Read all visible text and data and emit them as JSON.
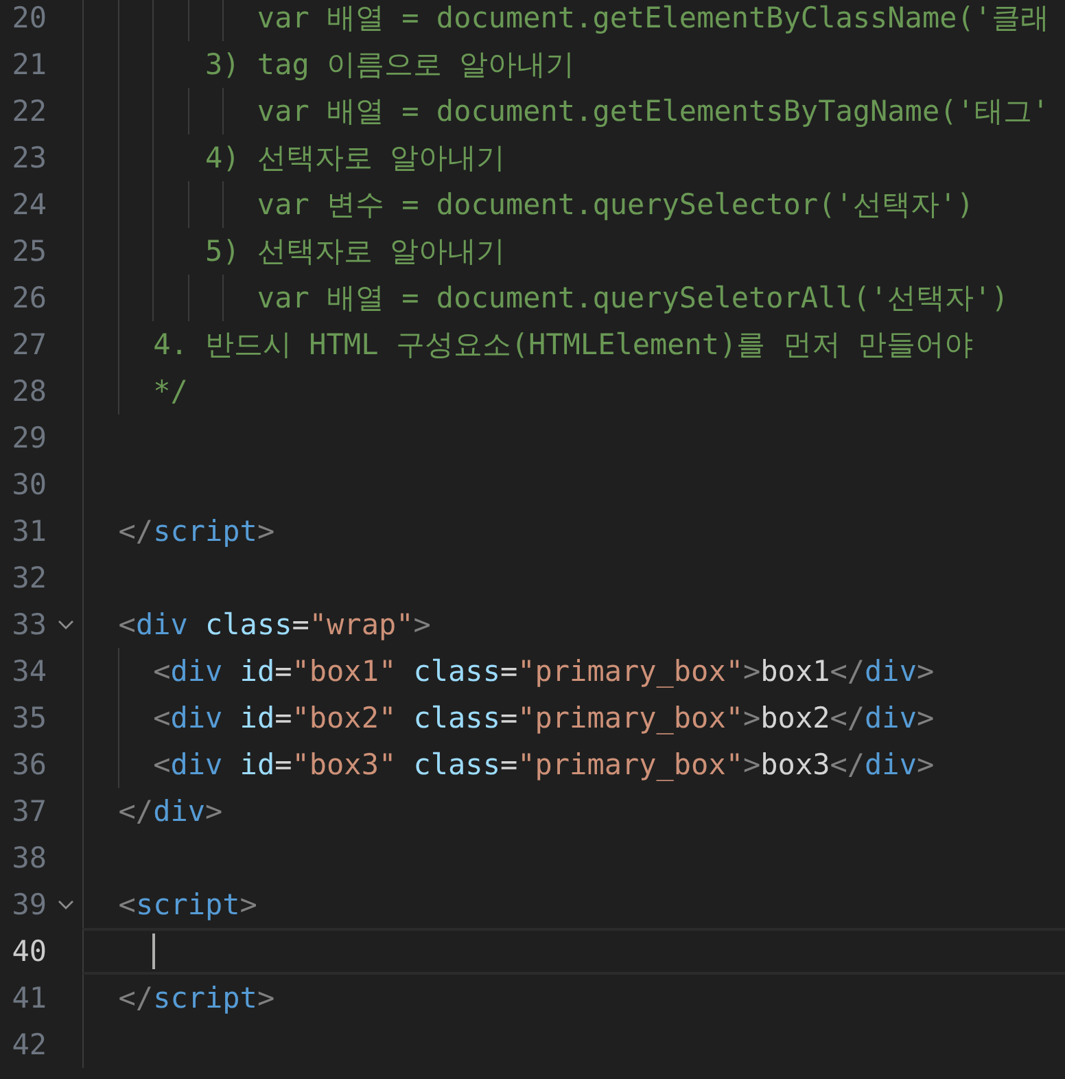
{
  "editor": {
    "lines": [
      {
        "number": "20",
        "fold": false,
        "current": false,
        "tokens": [
          {
            "kind": "comment",
            "text": "          var 배열 = document.getElementByClassName('클래"
          }
        ]
      },
      {
        "number": "21",
        "fold": false,
        "current": false,
        "tokens": [
          {
            "kind": "comment",
            "text": "       3) tag 이름으로 알아내기"
          }
        ]
      },
      {
        "number": "22",
        "fold": false,
        "current": false,
        "tokens": [
          {
            "kind": "comment",
            "text": "          var 배열 = document.getElementsByTagName('태그'"
          }
        ]
      },
      {
        "number": "23",
        "fold": false,
        "current": false,
        "tokens": [
          {
            "kind": "comment",
            "text": "       4) 선택자로 알아내기"
          }
        ]
      },
      {
        "number": "24",
        "fold": false,
        "current": false,
        "tokens": [
          {
            "kind": "comment",
            "text": "          var 변수 = document.querySelector('선택자')"
          }
        ]
      },
      {
        "number": "25",
        "fold": false,
        "current": false,
        "tokens": [
          {
            "kind": "comment",
            "text": "       5) 선택자로 알아내기"
          }
        ]
      },
      {
        "number": "26",
        "fold": false,
        "current": false,
        "tokens": [
          {
            "kind": "comment",
            "text": "          var 배열 = document.querySeletorAll('선택자')"
          }
        ]
      },
      {
        "number": "27",
        "fold": false,
        "current": false,
        "tokens": [
          {
            "kind": "comment",
            "text": "    4. 반드시 HTML 구성요소(HTMLElement)를 먼저 만들어야"
          }
        ]
      },
      {
        "number": "28",
        "fold": false,
        "current": false,
        "tokens": [
          {
            "kind": "comment",
            "text": "    */"
          }
        ]
      },
      {
        "number": "29",
        "fold": false,
        "current": false
      },
      {
        "number": "30",
        "fold": false,
        "current": false
      },
      {
        "number": "31",
        "fold": false,
        "current": false,
        "tokens": [
          {
            "kind": "punct",
            "text": "  </"
          },
          {
            "kind": "tag",
            "text": "script"
          },
          {
            "kind": "punct",
            "text": ">"
          }
        ]
      },
      {
        "number": "32",
        "fold": false,
        "current": false
      },
      {
        "number": "33",
        "fold": true,
        "current": false,
        "tokens": [
          {
            "kind": "punct",
            "text": "  <"
          },
          {
            "kind": "tag",
            "text": "div"
          },
          {
            "kind": "attr",
            "text": " class"
          },
          {
            "kind": "plain",
            "text": "="
          },
          {
            "kind": "string",
            "text": "\"wrap\""
          },
          {
            "kind": "punct",
            "text": ">"
          }
        ]
      },
      {
        "number": "34",
        "fold": false,
        "current": false,
        "tokens": [
          {
            "kind": "punct",
            "text": "    <"
          },
          {
            "kind": "tag",
            "text": "div"
          },
          {
            "kind": "attr",
            "text": " id"
          },
          {
            "kind": "plain",
            "text": "="
          },
          {
            "kind": "string",
            "text": "\"box1\""
          },
          {
            "kind": "attr",
            "text": " class"
          },
          {
            "kind": "plain",
            "text": "="
          },
          {
            "kind": "string",
            "text": "\"primary_box\""
          },
          {
            "kind": "punct",
            "text": ">"
          },
          {
            "kind": "plain",
            "text": "box1"
          },
          {
            "kind": "punct",
            "text": "</"
          },
          {
            "kind": "tag",
            "text": "div"
          },
          {
            "kind": "punct",
            "text": ">"
          }
        ]
      },
      {
        "number": "35",
        "fold": false,
        "current": false,
        "tokens": [
          {
            "kind": "punct",
            "text": "    <"
          },
          {
            "kind": "tag",
            "text": "div"
          },
          {
            "kind": "attr",
            "text": " id"
          },
          {
            "kind": "plain",
            "text": "="
          },
          {
            "kind": "string",
            "text": "\"box2\""
          },
          {
            "kind": "attr",
            "text": " class"
          },
          {
            "kind": "plain",
            "text": "="
          },
          {
            "kind": "string",
            "text": "\"primary_box\""
          },
          {
            "kind": "punct",
            "text": ">"
          },
          {
            "kind": "plain",
            "text": "box2"
          },
          {
            "kind": "punct",
            "text": "</"
          },
          {
            "kind": "tag",
            "text": "div"
          },
          {
            "kind": "punct",
            "text": ">"
          }
        ]
      },
      {
        "number": "36",
        "fold": false,
        "current": false,
        "tokens": [
          {
            "kind": "punct",
            "text": "    <"
          },
          {
            "kind": "tag",
            "text": "div"
          },
          {
            "kind": "attr",
            "text": " id"
          },
          {
            "kind": "plain",
            "text": "="
          },
          {
            "kind": "string",
            "text": "\"box3\""
          },
          {
            "kind": "attr",
            "text": " class"
          },
          {
            "kind": "plain",
            "text": "="
          },
          {
            "kind": "string",
            "text": "\"primary_box\""
          },
          {
            "kind": "punct",
            "text": ">"
          },
          {
            "kind": "plain",
            "text": "box3"
          },
          {
            "kind": "punct",
            "text": "</"
          },
          {
            "kind": "tag",
            "text": "div"
          },
          {
            "kind": "punct",
            "text": ">"
          }
        ]
      },
      {
        "number": "37",
        "fold": false,
        "current": false,
        "tokens": [
          {
            "kind": "punct",
            "text": "  </"
          },
          {
            "kind": "tag",
            "text": "div"
          },
          {
            "kind": "punct",
            "text": ">"
          }
        ]
      },
      {
        "number": "38",
        "fold": false,
        "current": false
      },
      {
        "number": "39",
        "fold": true,
        "current": false,
        "tokens": [
          {
            "kind": "punct",
            "text": "  <"
          },
          {
            "kind": "tag",
            "text": "script"
          },
          {
            "kind": "punct",
            "text": ">"
          }
        ]
      },
      {
        "number": "40",
        "fold": false,
        "current": true
      },
      {
        "number": "41",
        "fold": false,
        "current": false,
        "tokens": [
          {
            "kind": "punct",
            "text": "  </"
          },
          {
            "kind": "tag",
            "text": "script"
          },
          {
            "kind": "punct",
            "text": ">"
          }
        ]
      },
      {
        "number": "42",
        "fold": false,
        "current": false
      }
    ]
  }
}
